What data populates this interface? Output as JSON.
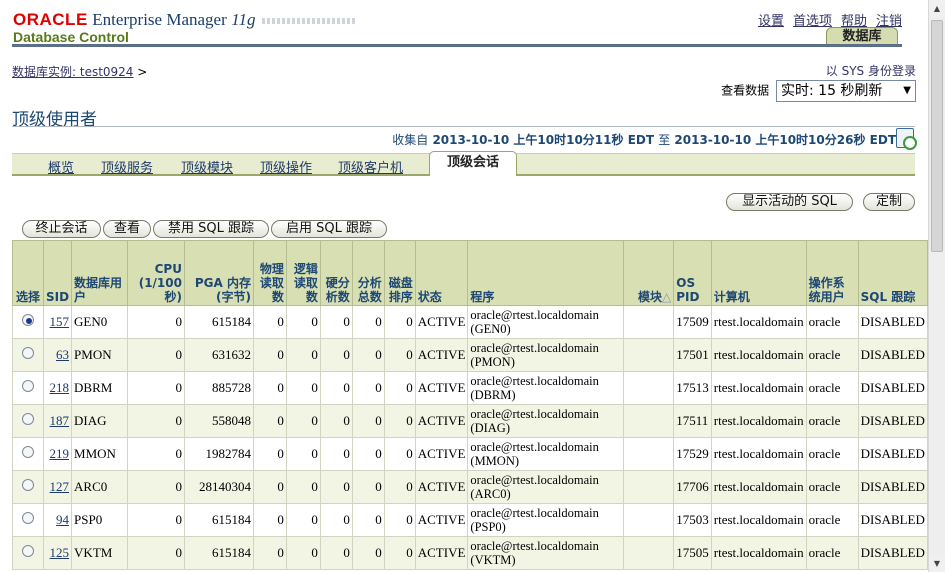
{
  "header": {
    "oracle": "ORACLE",
    "em": "Enterprise Manager",
    "version": "11",
    "version_suffix": "g",
    "product": "Database Control",
    "links": [
      "设置",
      "首选项",
      "帮助",
      "注销"
    ],
    "db_tab": "数据库"
  },
  "breadcrumb": {
    "link": "数据库实例: test0924",
    "sep": ">"
  },
  "login_as": "以 SYS 身份登录",
  "view_data": {
    "label": "查看数据",
    "value": "实时: 15 秒刷新"
  },
  "page_title": "顶级使用者",
  "collected": {
    "prefix": "收集自",
    "start": "2013-10-10 上午10时10分11秒",
    "tz1": "EDT",
    "mid": "至",
    "end": "2013-10-10 上午10时10分26秒",
    "tz2": "EDT"
  },
  "subtabs": [
    "概览",
    "顶级服务",
    "顶级模块",
    "顶级操作",
    "顶级客户机"
  ],
  "active_subtab": "顶级会话",
  "buttons": {
    "show_sql": "显示活动的 SQL",
    "customize": "定制",
    "kill": "终止会话",
    "view": "查看",
    "disable_trace": "禁用 SQL 跟踪",
    "enable_trace": "启用 SQL 跟踪"
  },
  "table": {
    "headers": {
      "select": "选择",
      "sid": "SID",
      "db_user": "数据库用户",
      "cpu": "CPU (1/100秒)",
      "pga": "PGA 内存 (字节)",
      "phys": "物理读取数",
      "logical": "逻辑读取数",
      "hard_parse": "硬分析数",
      "total_parse": "分析总数",
      "disk_sort": "磁盘排序",
      "status": "状态",
      "program": "程序",
      "module": "模块",
      "sort_icon": "△",
      "os_pid": "OS PID",
      "machine": "计算机",
      "os_user": "操作系统用户",
      "sql_trace": "SQL 跟踪"
    },
    "rows": [
      {
        "selected": true,
        "sid": "157",
        "user": "GEN0",
        "cpu": "0",
        "pga": "615184",
        "phys": "0",
        "logical": "0",
        "hard": "0",
        "total": "0",
        "disk": "0",
        "status": "ACTIVE",
        "prog1": "oracle@rtest.localdomain",
        "prog2": "(GEN0)",
        "module": "",
        "ospid": "17509",
        "machine": "rtest.localdomain",
        "osuser": "oracle",
        "trace": "DISABLED"
      },
      {
        "selected": false,
        "sid": "63",
        "user": "PMON",
        "cpu": "0",
        "pga": "631632",
        "phys": "0",
        "logical": "0",
        "hard": "0",
        "total": "0",
        "disk": "0",
        "status": "ACTIVE",
        "prog1": "oracle@rtest.localdomain",
        "prog2": "(PMON)",
        "module": "",
        "ospid": "17501",
        "machine": "rtest.localdomain",
        "osuser": "oracle",
        "trace": "DISABLED"
      },
      {
        "selected": false,
        "sid": "218",
        "user": "DBRM",
        "cpu": "0",
        "pga": "885728",
        "phys": "0",
        "logical": "0",
        "hard": "0",
        "total": "0",
        "disk": "0",
        "status": "ACTIVE",
        "prog1": "oracle@rtest.localdomain",
        "prog2": "(DBRM)",
        "module": "",
        "ospid": "17513",
        "machine": "rtest.localdomain",
        "osuser": "oracle",
        "trace": "DISABLED"
      },
      {
        "selected": false,
        "sid": "187",
        "user": "DIAG",
        "cpu": "0",
        "pga": "558048",
        "phys": "0",
        "logical": "0",
        "hard": "0",
        "total": "0",
        "disk": "0",
        "status": "ACTIVE",
        "prog1": "oracle@rtest.localdomain",
        "prog2": "(DIAG)",
        "module": "",
        "ospid": "17511",
        "machine": "rtest.localdomain",
        "osuser": "oracle",
        "trace": "DISABLED"
      },
      {
        "selected": false,
        "sid": "219",
        "user": "MMON",
        "cpu": "0",
        "pga": "1982784",
        "phys": "0",
        "logical": "0",
        "hard": "0",
        "total": "0",
        "disk": "0",
        "status": "ACTIVE",
        "prog1": "oracle@rtest.localdomain",
        "prog2": "(MMON)",
        "module": "",
        "ospid": "17529",
        "machine": "rtest.localdomain",
        "osuser": "oracle",
        "trace": "DISABLED"
      },
      {
        "selected": false,
        "sid": "127",
        "user": "ARC0",
        "cpu": "0",
        "pga": "28140304",
        "phys": "0",
        "logical": "0",
        "hard": "0",
        "total": "0",
        "disk": "0",
        "status": "ACTIVE",
        "prog1": "oracle@rtest.localdomain",
        "prog2": "(ARC0)",
        "module": "",
        "ospid": "17706",
        "machine": "rtest.localdomain",
        "osuser": "oracle",
        "trace": "DISABLED"
      },
      {
        "selected": false,
        "sid": "94",
        "user": "PSP0",
        "cpu": "0",
        "pga": "615184",
        "phys": "0",
        "logical": "0",
        "hard": "0",
        "total": "0",
        "disk": "0",
        "status": "ACTIVE",
        "prog1": "oracle@rtest.localdomain",
        "prog2": "(PSP0)",
        "module": "",
        "ospid": "17503",
        "machine": "rtest.localdomain",
        "osuser": "oracle",
        "trace": "DISABLED"
      },
      {
        "selected": false,
        "sid": "125",
        "user": "VKTM",
        "cpu": "0",
        "pga": "615184",
        "phys": "0",
        "logical": "0",
        "hard": "0",
        "total": "0",
        "disk": "0",
        "status": "ACTIVE",
        "prog1": "oracle@rtest.localdomain",
        "prog2": "(VKTM)",
        "module": "",
        "ospid": "17505",
        "machine": "rtest.localdomain",
        "osuser": "oracle",
        "trace": "DISABLED"
      }
    ]
  }
}
